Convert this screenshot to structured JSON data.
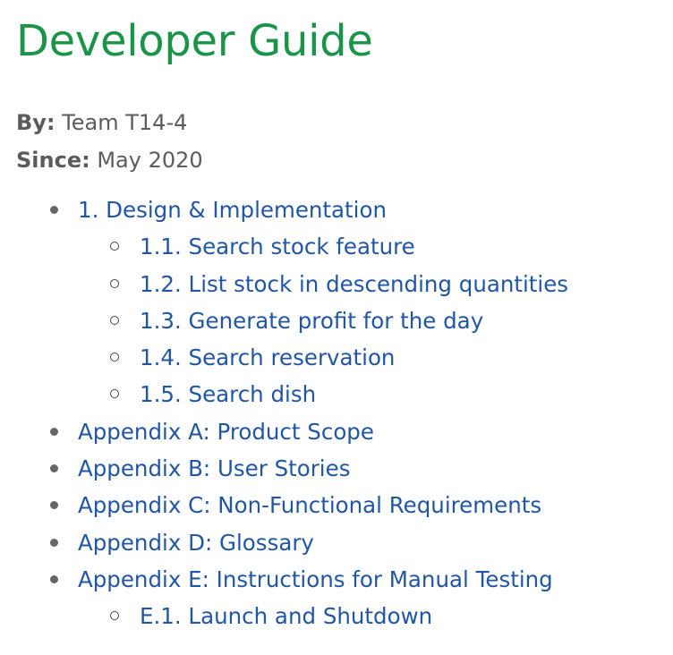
{
  "title": "Developer Guide",
  "meta": {
    "by_label": "By:",
    "by_value": "Team T14-4",
    "since_label": "Since:",
    "since_value": "May 2020"
  },
  "toc": [
    {
      "level": 1,
      "label": "1. Design & Implementation"
    },
    {
      "level": 2,
      "label": "1.1. Search stock feature"
    },
    {
      "level": 2,
      "label": "1.2. List stock in descending quantities"
    },
    {
      "level": 2,
      "label": "1.3. Generate profit for the day"
    },
    {
      "level": 2,
      "label": "1.4. Search reservation"
    },
    {
      "level": 2,
      "label": "1.5. Search dish"
    },
    {
      "level": 1,
      "label": "Appendix A: Product Scope"
    },
    {
      "level": 1,
      "label": "Appendix B: User Stories"
    },
    {
      "level": 1,
      "label": "Appendix C: Non-Functional Requirements"
    },
    {
      "level": 1,
      "label": "Appendix D: Glossary"
    },
    {
      "level": 1,
      "label": "Appendix E: Instructions for Manual Testing"
    },
    {
      "level": 2,
      "label": "E.1. Launch and Shutdown"
    }
  ],
  "colors": {
    "title": "#1a9448",
    "link": "#2156a5",
    "text": "#5c5c5c"
  }
}
